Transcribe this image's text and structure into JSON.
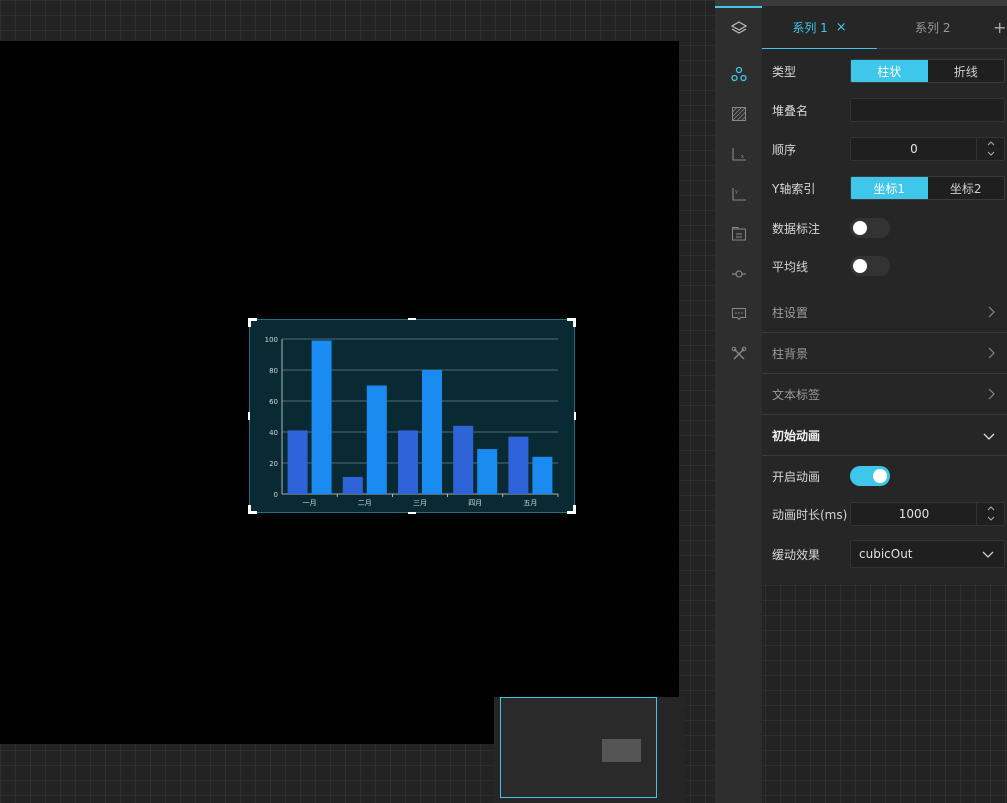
{
  "minimap": {},
  "rail": {
    "icons": [
      "layers-icon",
      "series-icon",
      "grid-pattern-icon",
      "x-axis-icon",
      "y-axis-icon",
      "legend-icon",
      "marker-line-icon",
      "tooltip-icon",
      "tools-icon"
    ]
  },
  "panel": {
    "tabs": [
      {
        "label": "系列 1",
        "close": "×"
      },
      {
        "label": "系列 2"
      }
    ],
    "add_tab": "+",
    "type": {
      "label": "类型",
      "options": [
        "柱状",
        "折线"
      ],
      "selected": "柱状"
    },
    "stack": {
      "label": "堆叠名",
      "value": ""
    },
    "order": {
      "label": "顺序",
      "value": "0"
    },
    "y_axis_index": {
      "label": "Y轴索引",
      "options": [
        "坐标1",
        "坐标2"
      ],
      "selected": "坐标1"
    },
    "data_label": {
      "label": "数据标注",
      "on": false
    },
    "average_line": {
      "label": "平均线",
      "on": false
    },
    "sections": {
      "bar_settings": "柱设置",
      "bar_background": "柱背景",
      "text_label": "文本标签",
      "initial_animation": "初始动画"
    },
    "animation": {
      "enable_label": "开启动画",
      "enabled": true,
      "duration_label": "动画时长(ms)",
      "duration": "1000",
      "easing_label": "缓动效果",
      "easing": "cubicOut"
    }
  },
  "colors": {
    "accent": "#3ec7ea",
    "bar_dark": "#2f64d8",
    "bar_light": "#1a8bf0",
    "widget_bg": "#0a2a33"
  },
  "chart_data": {
    "type": "bar",
    "categories": [
      "一月",
      "二月",
      "三月",
      "四月",
      "五月"
    ],
    "series": [
      {
        "values": [
          41,
          11,
          41,
          44,
          37
        ]
      },
      {
        "values": [
          99,
          70,
          80,
          29,
          24
        ]
      }
    ],
    "ylim": [
      0,
      100
    ],
    "yticks": [
      "0",
      "20",
      "40",
      "60",
      "80",
      "100"
    ],
    "grid": true
  }
}
